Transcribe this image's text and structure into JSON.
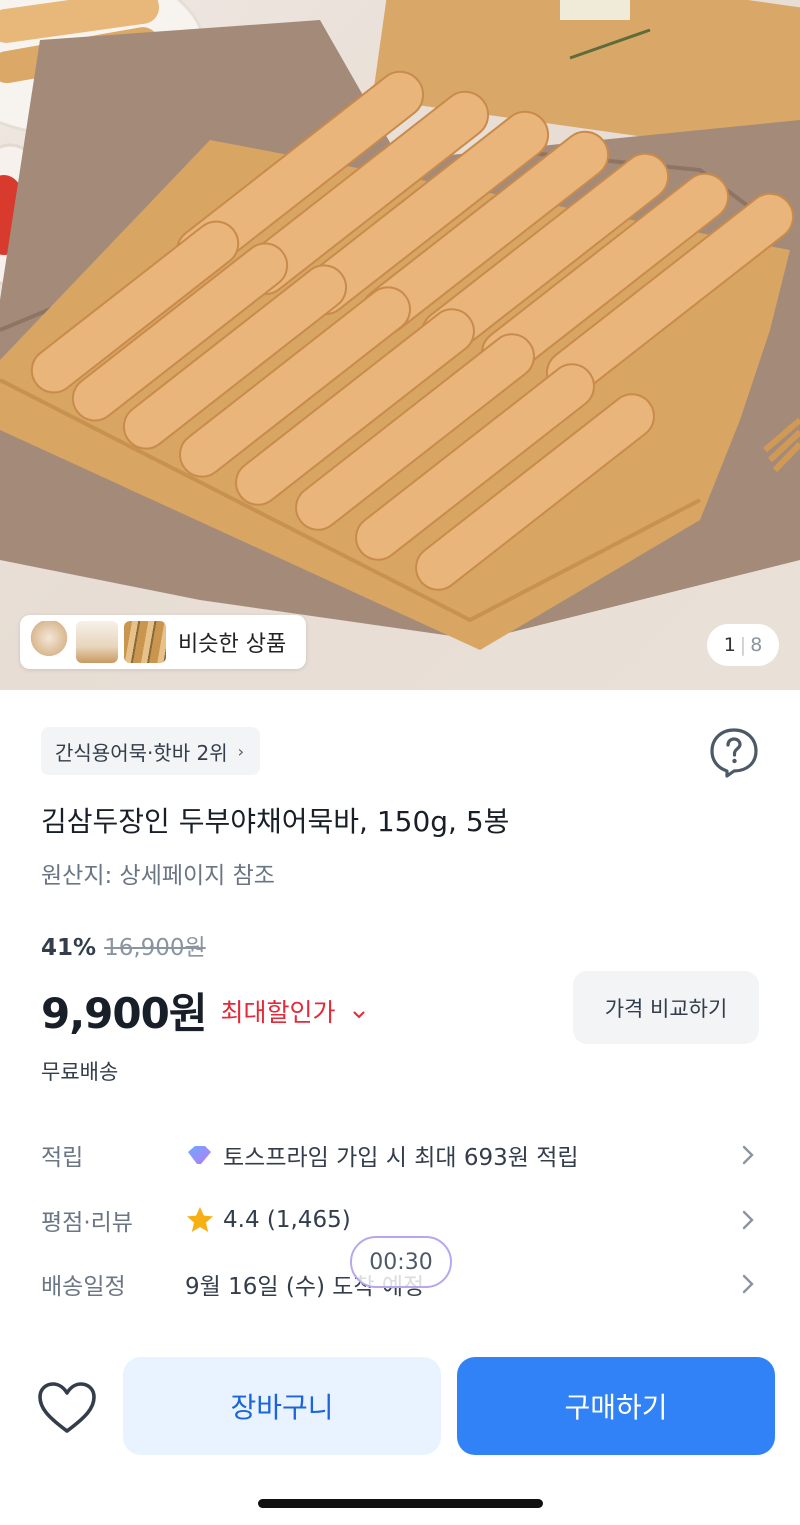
{
  "hero": {
    "similar_label": "비슷한 상품",
    "pager_current": "1",
    "pager_separator": "|",
    "pager_total": "8"
  },
  "product": {
    "category_rank": "간식용어묵·핫바 2위",
    "title": "김삼두장인 두부야채어묵바, 150g, 5봉",
    "origin": "원산지: 상세페이지 참조",
    "discount_rate": "41%",
    "original_price": "16,900원",
    "price": "9,900원",
    "max_discount_label": "최대할인가",
    "compare_label": "가격 비교하기",
    "shipping": "무료배송"
  },
  "info_rows": {
    "points_label": "적립",
    "points_value": "토스프라임 가입 시 최대 693원 적립",
    "rating_label": "평점·리뷰",
    "rating_value": "4.4 (1,465)",
    "delivery_label": "배송일정",
    "delivery_value": "9월 16일 (수) 도착 예정"
  },
  "timer": "00:30",
  "bottom_bar": {
    "cart_label": "장바구니",
    "buy_label": "구매하기"
  },
  "colors": {
    "primary": "#3182f6",
    "primary_light": "#e8f3ff",
    "discount_red": "#e42939",
    "star": "#f5b014"
  }
}
